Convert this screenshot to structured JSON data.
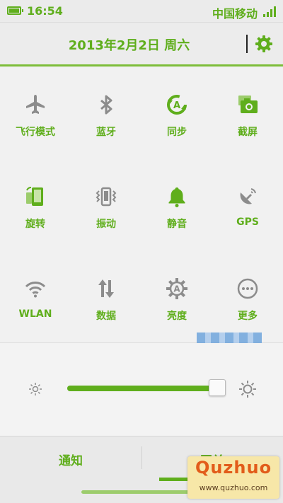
{
  "status_bar": {
    "time": "16:54",
    "carrier": "中国移动"
  },
  "header": {
    "date": "2013年2月2日 周六"
  },
  "toggles": [
    {
      "label": "飞行模式",
      "icon": "airplane-icon",
      "color": "#8c8c8c"
    },
    {
      "label": "蓝牙",
      "icon": "bluetooth-icon",
      "color": "#8c8c8c"
    },
    {
      "label": "同步",
      "icon": "sync-icon",
      "color": "#5fae1c"
    },
    {
      "label": "截屏",
      "icon": "screenshot-icon",
      "color": "#5fae1c"
    },
    {
      "label": "旋转",
      "icon": "rotate-icon",
      "color": "#5fae1c"
    },
    {
      "label": "振动",
      "icon": "vibrate-icon",
      "color": "#8c8c8c"
    },
    {
      "label": "静音",
      "icon": "bell-icon",
      "color": "#5fae1c"
    },
    {
      "label": "GPS",
      "icon": "gps-icon",
      "color": "#8c8c8c"
    },
    {
      "label": "WLAN",
      "icon": "wifi-icon",
      "color": "#8c8c8c"
    },
    {
      "label": "数据",
      "icon": "data-icon",
      "color": "#8c8c8c"
    },
    {
      "label": "亮度",
      "icon": "brightness-auto-icon",
      "color": "#8c8c8c"
    },
    {
      "label": "更多",
      "icon": "more-icon",
      "color": "#8c8c8c"
    }
  ],
  "brightness": {
    "level": 0.95
  },
  "tabs": {
    "notify": "通知",
    "switch": "开关"
  },
  "watermark": {
    "title": "Quzhuo",
    "url": "www.quzhuo.com"
  },
  "colors": {
    "accent": "#5fae1c",
    "inactive": "#8c8c8c"
  }
}
